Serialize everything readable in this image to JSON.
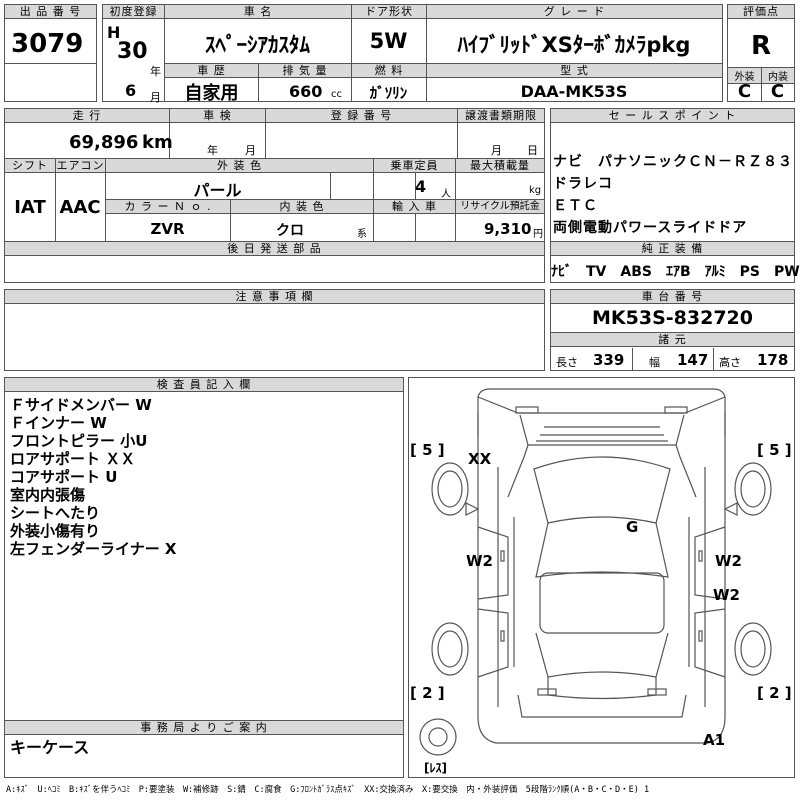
{
  "top": {
    "h_lot_no": "出 品 番 号",
    "lot_no": "3079",
    "h_first_reg": "初度登録",
    "era": "H",
    "year_num": "30",
    "year_unit": "年",
    "month_num": "6",
    "month_unit": "月",
    "h_car_name": "車 名",
    "car_name": "ｽﾍﾟｰｼｱｶｽﾀﾑ",
    "h_door": "ドア形状",
    "door": "5W",
    "h_grade": "グ レ ー ド",
    "grade": "ﾊｲﾌﾞﾘｯﾄﾞXSﾀｰﾎﾞｶﾒﾗpkg",
    "h_score": "評価点",
    "score": "R",
    "h_history": "車 歴",
    "history": "自家用",
    "h_displacement": "排 気 量",
    "displacement": "660",
    "displacement_unit": "cc",
    "h_fuel": "燃 料",
    "fuel": "ｶﾞｿﾘﾝ",
    "h_model": "型 式",
    "model": "DAA-MK53S",
    "h_ext": "外装",
    "ext": "C",
    "h_int": "内装",
    "int": "C"
  },
  "row2": {
    "h_mileage": "走 行",
    "mileage": "69,896",
    "mileage_unit": "km",
    "h_inspection": "車 検",
    "insp_year_unit": "年",
    "insp_month_unit": "月",
    "h_reg_no": "登 録 番 号",
    "h_transfer_doc": "譲渡書類期限",
    "doc_month_unit": "月",
    "doc_day_unit": "日",
    "h_shift": "シフト",
    "shift": "IAT",
    "h_ac": "エアコン",
    "ac": "AAC",
    "h_exterior_color": "外 装 色",
    "exterior_color": "パール",
    "h_capacity": "乗車定員",
    "capacity": "4",
    "capacity_unit": "人",
    "h_max_load": "最大積載量",
    "max_load_unit": "kg",
    "h_color_no": "カ ラ ー Ｎ ｏ .",
    "color_no": "ZVR",
    "h_interior_color": "内 装 色",
    "interior_color": "クロ",
    "interior_color_unit": "系",
    "h_import": "輸 入 車",
    "h_recycle": "リサイクル預託金",
    "recycle": "9,310",
    "recycle_unit": "円",
    "h_later_parts": "後 日 発 送 部 品"
  },
  "sales": {
    "h_sales_points": "セ ー ル ス ポ イ ン ト",
    "lines": [
      "ナビ　パナソニックＣＮ－ＲＺ８３",
      "ドラレコ",
      "ＥＴＣ",
      "両側電動パワースライドドア"
    ],
    "h_equipment": "純 正 装 備",
    "equipment": "ﾅﾋﾞ　TV　ABS　ｴｱB　ｱﾙﾐ　PS　PW",
    "h_chassis": "車 台 番 号",
    "chassis": "MK53S-832720",
    "h_specs": "諸 元",
    "length_label": "長さ",
    "length": "339",
    "width_label": "幅",
    "width": "147",
    "height_label": "高さ",
    "height": "178"
  },
  "caution": {
    "h_caution": "注 意 事 項 欄"
  },
  "inspector": {
    "h_inspector": "検 査 員 記 入 欄",
    "lines": [
      "Ｆサイドメンバー W",
      "Ｆインナー W",
      "フロントピラー 小U",
      "ロアサポート ＸＸ",
      "コアサポート U",
      "室内内張傷",
      "シートへたり",
      "外装小傷有り",
      "左フェンダーライナー X"
    ]
  },
  "office": {
    "h_office": "事 務 局 よ り ご 案 内",
    "text": "キーケース"
  },
  "diagram": {
    "tire_fl": "[ 5 ]",
    "tire_fr": "[ 5 ]",
    "tire_rl": "[ 2 ]",
    "tire_rr": "[ 2 ]",
    "spare": "[ﾚｽ]",
    "mark_xx": "XX",
    "mark_g": "G",
    "mark_w2_left": "W2",
    "mark_w2_right1": "W2",
    "mark_w2_right2": "W2",
    "mark_a1": "A1"
  },
  "legend": "A:ｷｽﾞ　U:ﾍｺﾐ　B:ｷｽﾞを伴うﾍｺﾐ　P:要塗装　W:補修跡　S:錆　C:腐食　G:ﾌﾛﾝﾄｶﾞﾗｽ点ｷｽﾞ　XX:交換済み　X:要交換　内・外装評価　5段階ﾗﾝｸ順(A・B・C・D・E) 1"
}
